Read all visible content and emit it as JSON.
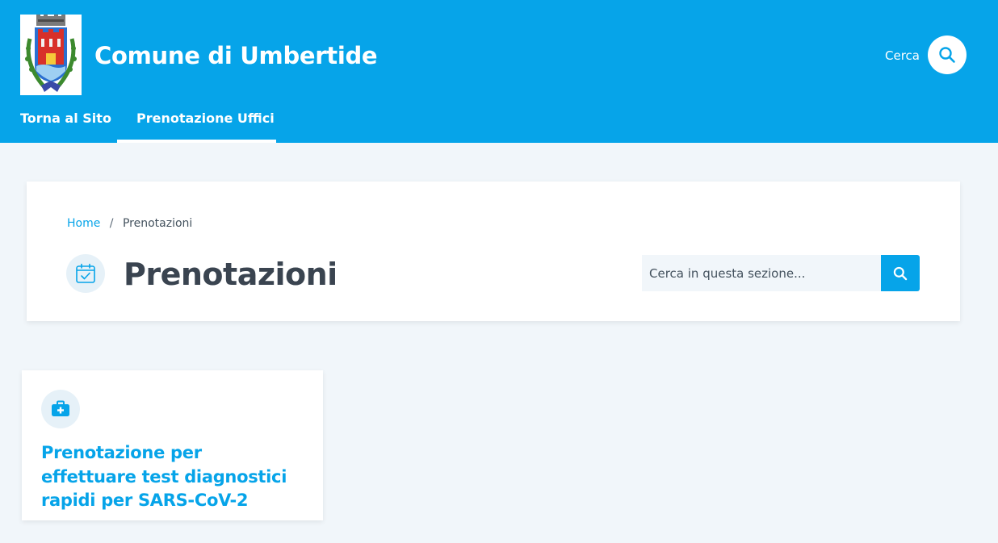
{
  "header": {
    "site_title": "Comune di Umbertide",
    "search_label": "Cerca",
    "nav": [
      {
        "label": "Torna al Sito"
      },
      {
        "label": "Prenotazione Uffici"
      }
    ]
  },
  "breadcrumb": {
    "home": "Home",
    "separator": "/",
    "current": "Prenotazioni"
  },
  "page": {
    "title": "Prenotazioni",
    "search_placeholder": "Cerca in questa sezione..."
  },
  "cards": [
    {
      "title": "Prenotazione per effettuare test diagnostici rapidi per SARS-CoV-2"
    }
  ],
  "colors": {
    "primary": "#06a4e9",
    "background": "#f1f6fa",
    "icon_circle": "#e6f1f8"
  },
  "icons": {
    "logo": "coat-of-arms-logo",
    "search": "search-icon",
    "title": "calendar-check-icon",
    "card": "medical-kit-icon"
  }
}
